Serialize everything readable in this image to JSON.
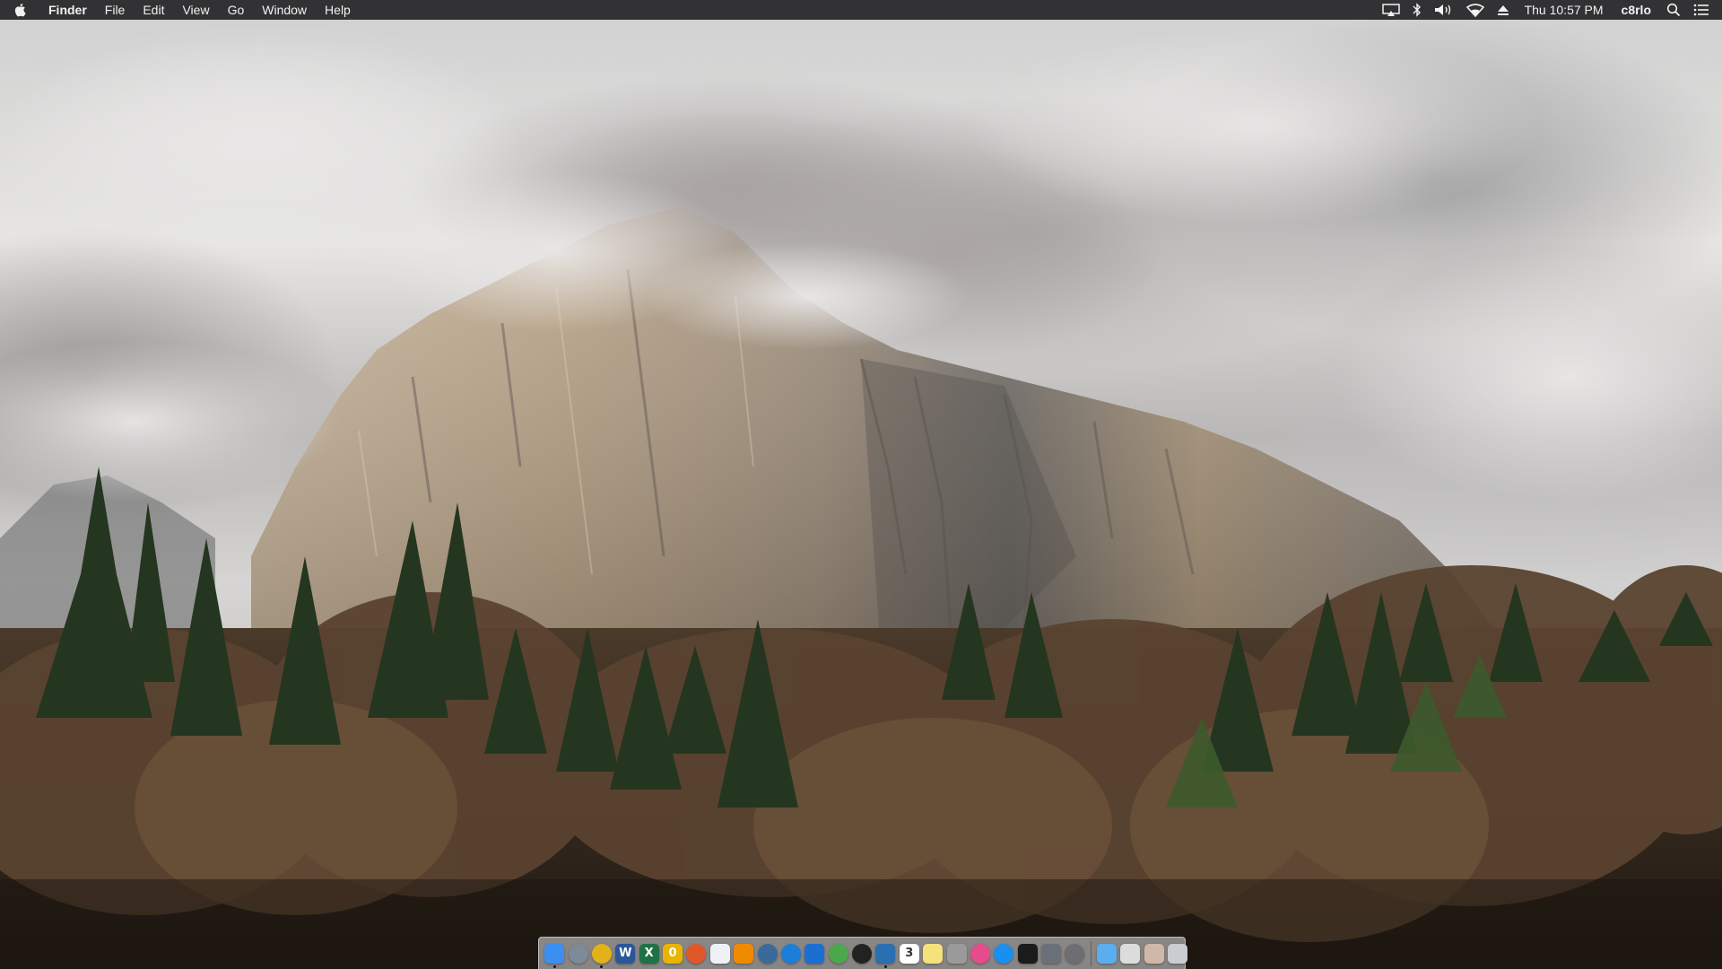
{
  "menubar": {
    "apple_menu": "apple-icon",
    "app_name": "Finder",
    "menus": [
      "File",
      "Edit",
      "View",
      "Go",
      "Window",
      "Help"
    ],
    "status_icons": [
      "airplay-icon",
      "bluetooth-icon",
      "volume-icon",
      "wifi-icon",
      "eject-icon"
    ],
    "clock": "Thu 10:57 PM",
    "user": "c8rlo",
    "right_icons": [
      "spotlight-search-icon",
      "notification-center-icon"
    ]
  },
  "wallpaper": {
    "subject": "El Capitan"
  },
  "dock": {
    "apps": [
      {
        "name": "finder",
        "glyph": "",
        "color": "#3b8ff0",
        "running": true
      },
      {
        "name": "launchpad",
        "glyph": "",
        "color": "#7d8a99",
        "running": false
      },
      {
        "name": "chrome",
        "glyph": "",
        "color": "#e3b21a",
        "running": true
      },
      {
        "name": "word",
        "glyph": "W",
        "color": "#2b5797",
        "running": false
      },
      {
        "name": "excel",
        "glyph": "X",
        "color": "#1f7244",
        "running": false
      },
      {
        "name": "app-o",
        "glyph": "0",
        "color": "#e8b400",
        "running": false
      },
      {
        "name": "firefox",
        "glyph": "",
        "color": "#e0582a",
        "running": false
      },
      {
        "name": "preview",
        "glyph": "",
        "color": "#eef2f7",
        "running": false
      },
      {
        "name": "vlc",
        "glyph": "",
        "color": "#f08a00",
        "running": false
      },
      {
        "name": "app-c",
        "glyph": "",
        "color": "#3a6a9a",
        "running": false
      },
      {
        "name": "edge",
        "glyph": "",
        "color": "#1c7ed6",
        "running": false
      },
      {
        "name": "teamviewer",
        "glyph": "",
        "color": "#1b6fd1",
        "running": false
      },
      {
        "name": "utorrent",
        "glyph": "",
        "color": "#4ca84c",
        "running": false
      },
      {
        "name": "app-disk",
        "glyph": "",
        "color": "#222222",
        "running": false
      },
      {
        "name": "xcode",
        "glyph": "",
        "color": "#2a6fb0",
        "running": true
      },
      {
        "name": "calendar",
        "glyph": "3",
        "color": "#ffffff",
        "running": false
      },
      {
        "name": "notes",
        "glyph": "",
        "color": "#f4e27a",
        "running": false
      },
      {
        "name": "app-grey",
        "glyph": "",
        "color": "#9a9a9a",
        "running": false
      },
      {
        "name": "itunes",
        "glyph": "",
        "color": "#e64c8c",
        "running": false
      },
      {
        "name": "app-store",
        "glyph": "",
        "color": "#1a8ff0",
        "running": false
      },
      {
        "name": "terminal",
        "glyph": "",
        "color": "#1b1b1b",
        "running": false
      },
      {
        "name": "app-screen",
        "glyph": "",
        "color": "#6b7078",
        "running": false
      },
      {
        "name": "system-preferences",
        "glyph": "",
        "color": "#6d6d72",
        "running": false
      }
    ],
    "stacks": [
      {
        "name": "folder-stack",
        "color": "#5aaef0"
      },
      {
        "name": "documents-stack",
        "color": "#dcdcdc"
      },
      {
        "name": "downloads-stack",
        "color": "#d0b8a8"
      },
      {
        "name": "trash",
        "color": "#c9ccd1"
      }
    ]
  }
}
